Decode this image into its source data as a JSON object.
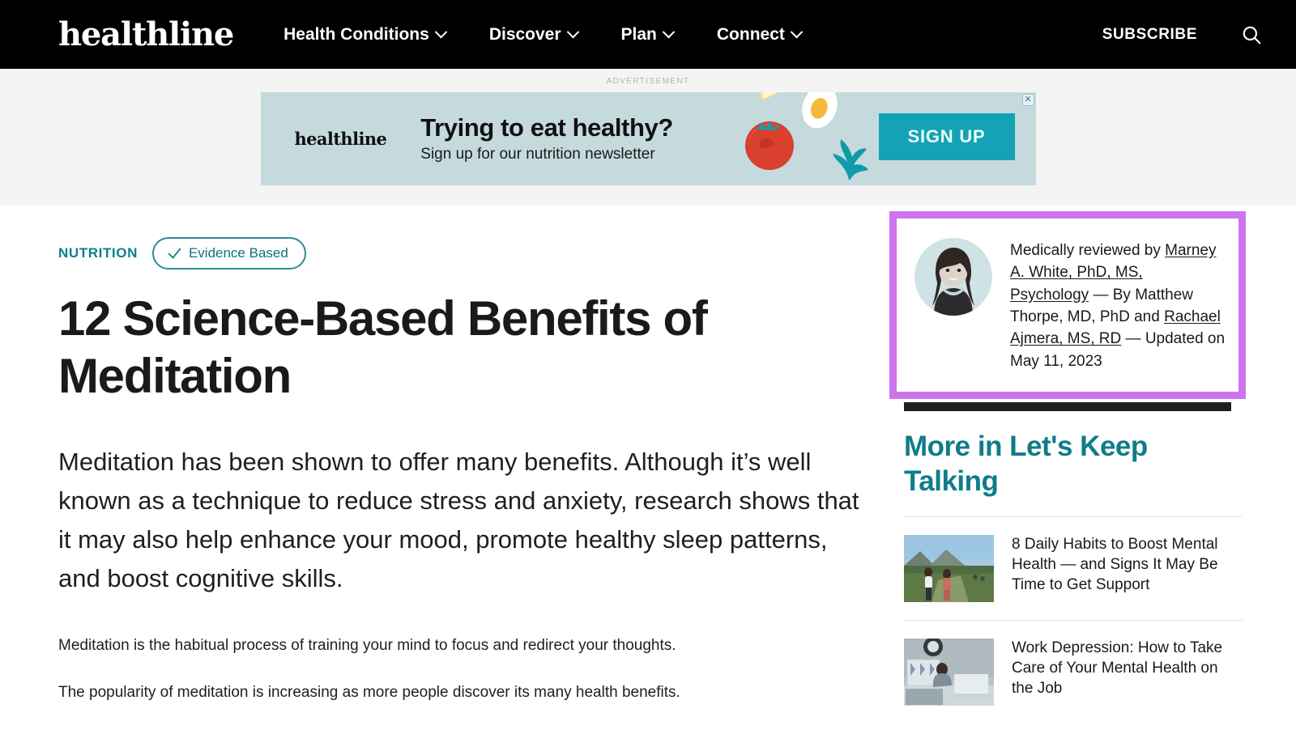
{
  "header": {
    "brand": "healthline",
    "nav": [
      {
        "label": "Health Conditions",
        "icon": "chevron-down-icon"
      },
      {
        "label": "Discover",
        "icon": "chevron-down-icon"
      },
      {
        "label": "Plan",
        "icon": "chevron-down-icon"
      },
      {
        "label": "Connect",
        "icon": "chevron-down-icon"
      }
    ],
    "subscribe_label": "SUBSCRIBE",
    "search_icon": "search-icon"
  },
  "ad": {
    "label": "ADVERTISEMENT",
    "brand": "healthline",
    "headline": "Trying to eat healthy?",
    "subhead": "Sign up for our nutrition newsletter",
    "cta_label": "SIGN UP",
    "close_label": "✕",
    "bg_color": "#c5dadd",
    "cta_color": "#13a3b4"
  },
  "article": {
    "kicker": "NUTRITION",
    "badge_label": "Evidence Based",
    "badge_icon": "check-icon",
    "title": "12 Science-Based Benefits of Meditation",
    "lede": "Meditation has been shown to offer many benefits. Although it’s well known as a technique to reduce stress and anxiety, research shows that it may also help enhance your mood, promote healthy sleep patterns, and boost cognitive skills.",
    "paragraphs": [
      "Meditation is the habitual process of training your mind to focus and redirect your thoughts.",
      "The popularity of meditation is increasing as more people discover its many health benefits."
    ],
    "accent_color": "#0e7f8c"
  },
  "byline": {
    "highlight_color": "#cf74ef",
    "prefix": "Medically reviewed by ",
    "reviewer": "Marney A. White, PhD, MS, Psychology",
    "separator": " — By ",
    "author_one": "Matthew Thorpe, MD, PhD",
    "and": " and ",
    "author_two": "Rachael Ajmera, MS, RD",
    "date_prefix": " — ",
    "date": "Updated on May 11, 2023",
    "avatar_alt": "reviewer-portrait"
  },
  "rail": {
    "section_title": "More in Let's Keep Talking",
    "section_color": "#0f7c89",
    "items": [
      {
        "title": "8 Daily Habits to Boost Mental Health — and Signs It May Be Time to Get Support",
        "thumb_alt": "two-women-hiking-outdoors"
      },
      {
        "title": "Work Depression: How to Take Care of Your Mental Health on the Job",
        "thumb_alt": "person-working-on-laptop-at-home"
      }
    ]
  }
}
